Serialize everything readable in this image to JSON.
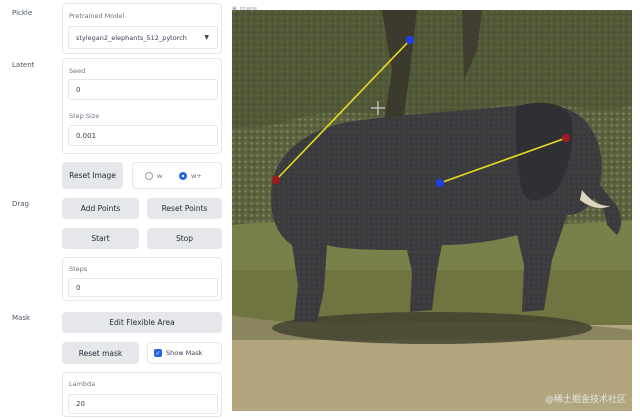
{
  "sections": {
    "pickle": "Pickle",
    "latent": "Latent",
    "drag": "Drag",
    "mask": "Mask"
  },
  "model": {
    "label": "Pretrained Model",
    "value": "stylegan2_elephants_512_pytorch"
  },
  "latent": {
    "seed_label": "Seed",
    "seed_value": "0",
    "step_label": "Step Size",
    "step_value": "0.001",
    "reset_image": "Reset Image",
    "radio_w": "w",
    "radio_wplus": "w+"
  },
  "drag": {
    "add_points": "Add Points",
    "reset_points": "Reset Points",
    "start": "Start",
    "stop": "Stop",
    "steps_label": "Steps",
    "steps_value": "0"
  },
  "mask": {
    "edit_area": "Edit Flexible Area",
    "reset_mask": "Reset mask",
    "show_mask": "Show Mask",
    "lambda_label": "Lambda",
    "lambda_value": "20"
  },
  "image_panel": {
    "tab_label": "Image",
    "watermark": "@稀土掘金技术社区"
  },
  "colors": {
    "handle_point": "#9b1c24",
    "target_point": "#1f3fe0",
    "drag_line": "#e8dc1e",
    "radio_selected": "#2563eb"
  }
}
